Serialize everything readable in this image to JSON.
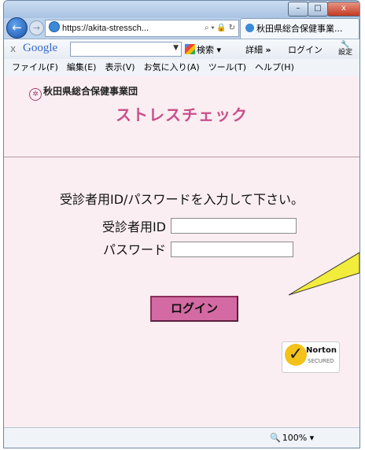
{
  "browser": {
    "address": "https://akita-stressch...",
    "address_controls": "⌕ ▾ 🔒 ↻",
    "tab_title": "秋田県総合保健事業...",
    "window_minimize": "–",
    "window_maximize": "□",
    "window_close": "x",
    "back_glyph": "←",
    "forward_glyph": "→"
  },
  "google_bar": {
    "close": "x",
    "logo": "Google",
    "search_label": "検索",
    "detail_label": "詳細",
    "login_label": "ログイン",
    "settings_label": "設定"
  },
  "menu": [
    "ファイル(F)",
    "編集(E)",
    "表示(V)",
    "お気に入り(A)",
    "ツール(T)",
    "ヘルプ(H)"
  ],
  "page": {
    "org_name": "秋田県総合保健事業団",
    "title": "ストレスチェック",
    "instruction": "受診者用ID/パスワードを入力して下さい。",
    "id_label": "受診者用ID",
    "id_value": "",
    "password_label": "パスワード",
    "password_value": "",
    "login_button": "ログイン",
    "norton_name": "Norton",
    "norton_sub": "SECURED"
  },
  "status": {
    "zoom": "100%"
  },
  "colors": {
    "title": "#c8508a",
    "page_background": "#fbeef2",
    "login_button": "#d46aa3",
    "callout": "#f2ec3c"
  },
  "icons": {
    "back": "back-arrow-icon",
    "forward": "forward-arrow-icon",
    "settings": "wrench-icon",
    "norton": "norton-check-icon",
    "zoom": "magnifier-icon"
  }
}
